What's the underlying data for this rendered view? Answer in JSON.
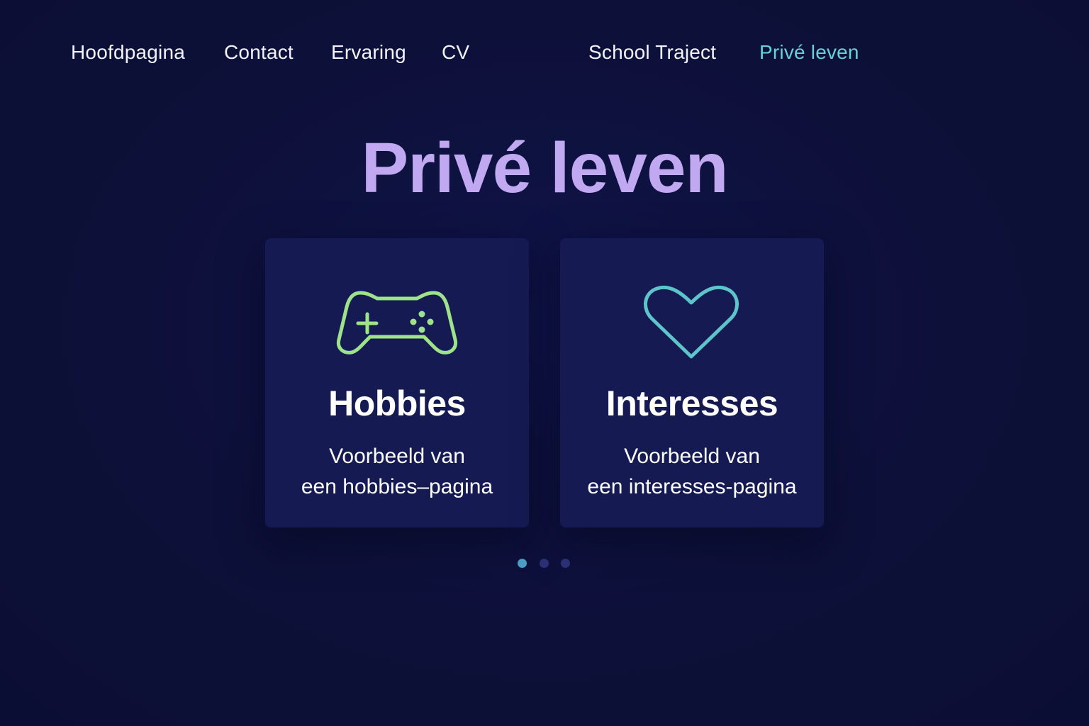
{
  "nav": {
    "items": [
      {
        "label": "Hoofdpagina"
      },
      {
        "label": "Contact"
      },
      {
        "label": "Ervaring"
      },
      {
        "label": "CV"
      },
      {
        "label": "School Traject"
      },
      {
        "label": "Privé leven"
      }
    ],
    "active_index": 5
  },
  "page": {
    "title": "Privé leven"
  },
  "cards": [
    {
      "icon": "gamepad-icon",
      "title": "Hobbies",
      "desc_line1": "Voorbeeld van",
      "desc_line2": "een hobbies–pagina",
      "icon_color": "#9ee38a"
    },
    {
      "icon": "heart-icon",
      "title": "Interesses",
      "desc_line1": "Voorbeeld van",
      "desc_line2": "een interesses-pagina",
      "icon_color": "#5ec4cc"
    }
  ],
  "carousel": {
    "page_count": 3,
    "active_page": 1
  },
  "colors": {
    "background": "#0d1038",
    "card": "#151a52",
    "title": "#c1a9f2",
    "nav_active": "#6ad0d8",
    "dot_active": "#4a9cc0",
    "dot_inactive": "#2a3073"
  }
}
